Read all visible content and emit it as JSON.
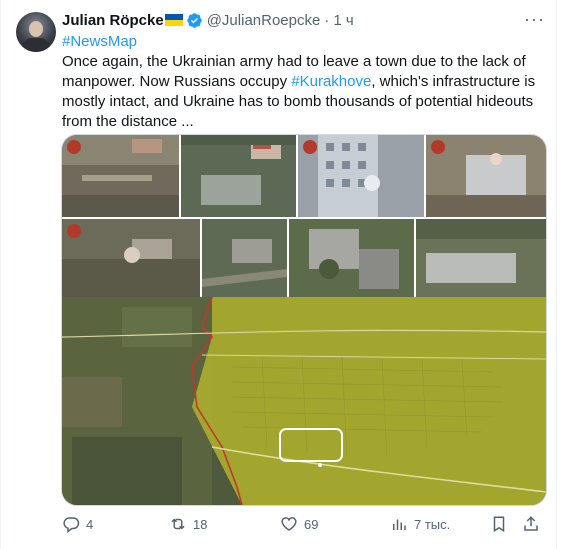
{
  "author": {
    "name": "Julian Röpcke",
    "handle": "@JulianRoepcke",
    "time": "1 ч"
  },
  "tweet": {
    "hashtag": "#NewsMap",
    "text_part1": "Once again, the Ukrainian army had to leave a town due to the lack of manpower. Now Russians occupy ",
    "link": "#Kurakhove",
    "text_part2": ", which's infrastructure is mostly intact, and Ukraine has to bomb thousands of potential hideouts from the distance ..."
  },
  "actions": {
    "replies": "4",
    "reposts": "18",
    "likes": "69",
    "views": "7 тыс."
  },
  "icons": {
    "more": "more-icon",
    "reply": "reply-icon",
    "repost": "repost-icon",
    "like": "heart-icon",
    "views": "views-icon",
    "bookmark": "bookmark-icon",
    "share": "share-icon"
  },
  "colors": {
    "link": "#1d9bf0",
    "muted": "#536471",
    "verified": "#1d9bf0",
    "map_overlay": "#c8c82c",
    "front_line": "#c0392b"
  }
}
